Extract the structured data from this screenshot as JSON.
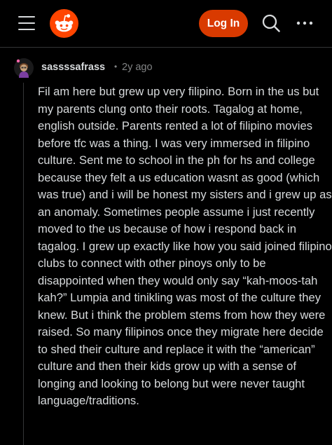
{
  "topbar": {
    "icons": {
      "menu": "hamburger-menu-icon",
      "logo": "reddit-logo-icon",
      "search": "search-icon",
      "more": "more-horizontal-icon"
    },
    "login_label": "Log In",
    "login_color": "#d93a00"
  },
  "comment": {
    "username": "sassssafrass",
    "separator": "•",
    "timestamp": "2y ago",
    "body": "Fil am here but grew up very filipino. Born in the us but my parents clung onto their roots. Tagalog at home, english outside. Parents rented a lot of filipino movies before tfc was a thing. I was very immersed in filipino culture. Sent me to school in the ph for hs and college because they felt a us education wasnt as good (which was true) and i will be honest my sisters and i grew up as an anomaly. Sometimes people assume i just recently moved to the us because of how i respond back in tagalog. I grew up exactly like how you said joined filipino clubs to connect with other pinoys only to be disappointed when they would only say “kah-moos-tah kah?” Lumpia and tinikling was most of the culture they knew. But i think the problem stems from how they were raised. So many filipinos once they migrate here decide to shed their culture and replace it with the “american” culture and then their kids grow up with a sense of longing and looking to belong but were never taught language/traditions."
  },
  "colors": {
    "background": "#000000",
    "text": "#d7dadc",
    "muted": "#818384",
    "divider": "#343536",
    "reddit_orange": "#ff4500"
  }
}
